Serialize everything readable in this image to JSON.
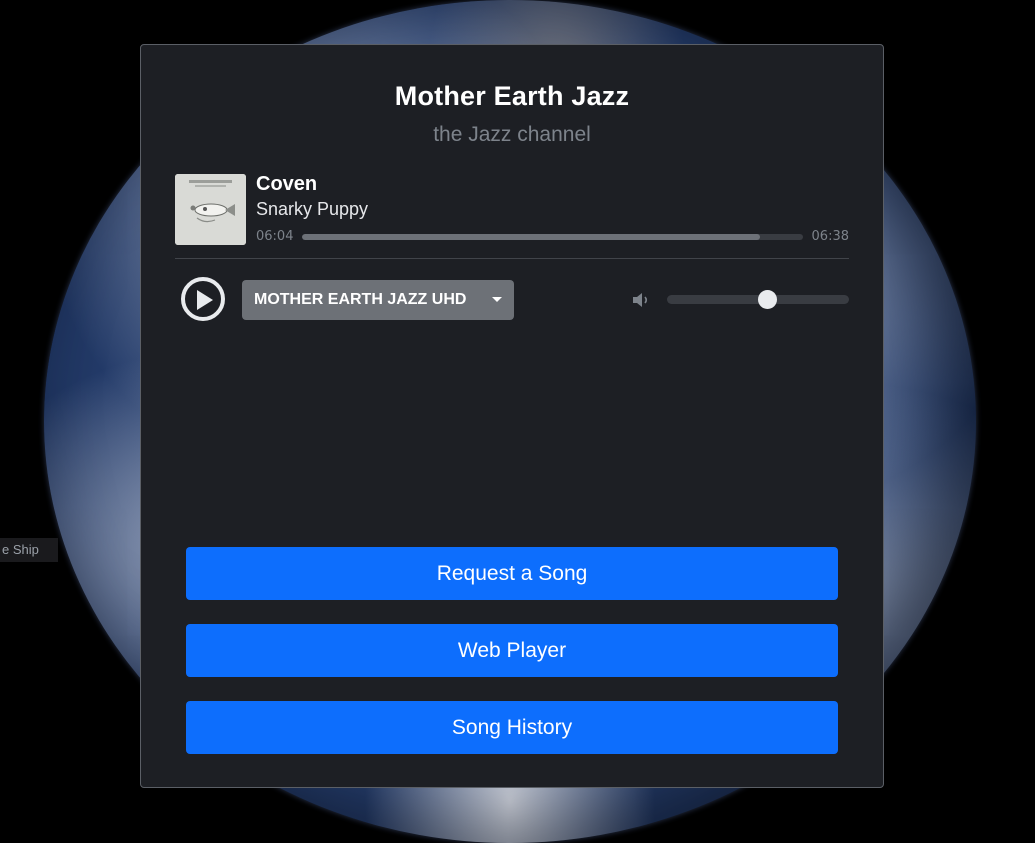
{
  "station": {
    "name": "Mother Earth Jazz",
    "tagline": "the Jazz channel"
  },
  "now_playing": {
    "title": "Coven",
    "artist": "Snarky Puppy",
    "elapsed": "06:04",
    "duration": "06:38",
    "progress_fraction": 0.915
  },
  "controls": {
    "stream_selected": "MOTHER EARTH JAZZ UHD",
    "volume_fraction": 0.55
  },
  "actions": {
    "request": "Request a Song",
    "web_player": "Web Player",
    "history": "Song History"
  },
  "background": {
    "edge_label": "e Ship"
  },
  "colors": {
    "panel": "#1d1f24",
    "accent": "#0d6efd",
    "select": "#6d7177"
  },
  "icons": {
    "play": "play-icon",
    "volume": "volume-icon",
    "caret": "chevron-down-icon"
  }
}
